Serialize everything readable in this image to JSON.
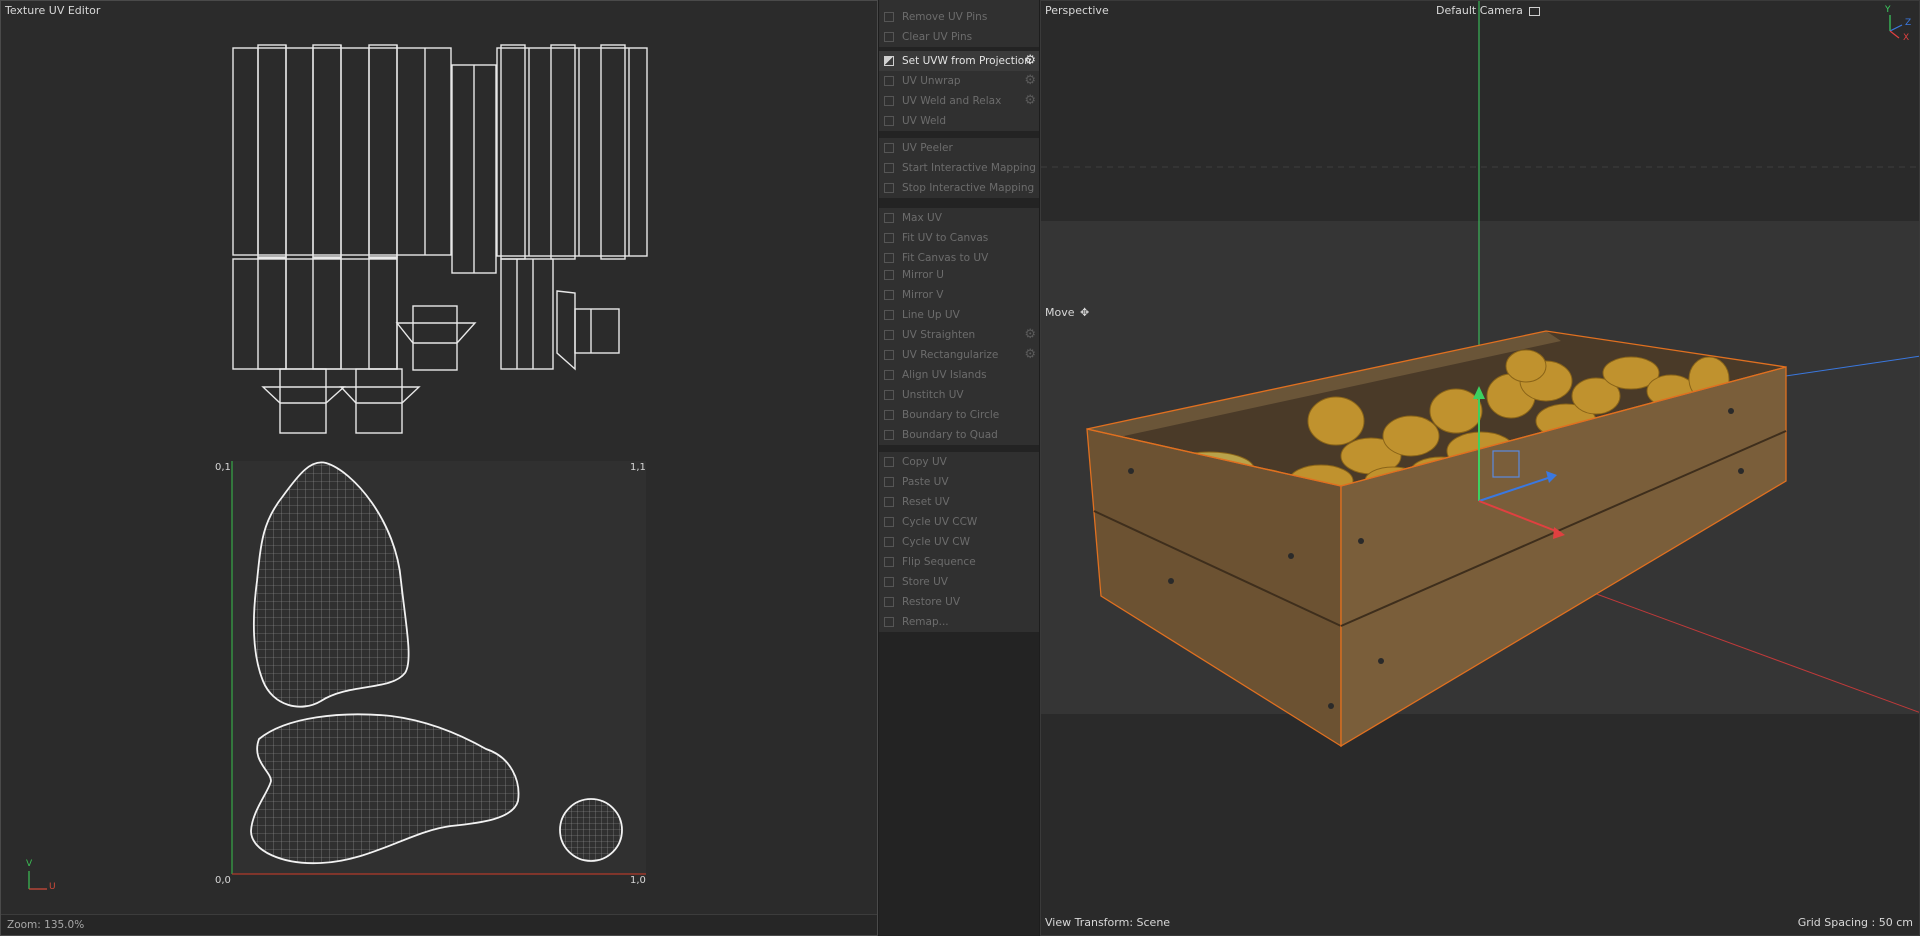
{
  "uv_editor": {
    "title": "Texture UV Editor",
    "corner_labels": {
      "top_left": "0,1",
      "top_right": "1,1",
      "bottom_left": "0,0",
      "bottom_right": "1,0"
    },
    "axis_v": "V",
    "axis_u": "U",
    "zoom": "Zoom: 135.0%"
  },
  "commands": {
    "groups": [
      [
        {
          "label": "Remove UV Pins",
          "icon": "pin-remove-icon",
          "enabled": false,
          "gear": false
        },
        {
          "label": "Clear UV Pins",
          "icon": "pin-clear-icon",
          "enabled": false,
          "gear": false
        }
      ],
      [
        {
          "label": "Set UVW from Projection",
          "icon": "projection-icon",
          "enabled": true,
          "gear": true
        },
        {
          "label": "UV Unwrap",
          "icon": "unwrap-icon",
          "enabled": false,
          "gear": true
        },
        {
          "label": "UV Weld and Relax",
          "icon": "weld-relax-icon",
          "enabled": false,
          "gear": true
        },
        {
          "label": "UV Weld",
          "icon": "weld-icon",
          "enabled": false,
          "gear": false
        }
      ],
      [
        {
          "label": "UV Peeler",
          "icon": "peeler-icon",
          "enabled": false,
          "gear": false
        },
        {
          "label": "Start Interactive Mapping",
          "icon": "play-icon",
          "enabled": false,
          "gear": false
        },
        {
          "label": "Stop Interactive Mapping",
          "icon": "stop-icon",
          "enabled": false,
          "gear": false
        }
      ],
      [
        {
          "label": "Max UV",
          "icon": "max-uv-icon",
          "enabled": false,
          "gear": false
        },
        {
          "label": "Fit UV to Canvas",
          "icon": "fit-uv-icon",
          "enabled": false,
          "gear": false
        },
        {
          "label": "Fit Canvas to UV",
          "icon": "fit-canvas-icon",
          "enabled": false,
          "gear": false
        }
      ],
      [
        {
          "label": "Mirror U",
          "icon": "mirror-u-icon",
          "enabled": false,
          "gear": false
        },
        {
          "label": "Mirror V",
          "icon": "mirror-v-icon",
          "enabled": false,
          "gear": false
        },
        {
          "label": "Line Up UV",
          "icon": "line-up-icon",
          "enabled": false,
          "gear": false
        },
        {
          "label": "UV Straighten",
          "icon": "straighten-icon",
          "enabled": false,
          "gear": true
        },
        {
          "label": "UV Rectangularize",
          "icon": "rectangularize-icon",
          "enabled": false,
          "gear": true
        },
        {
          "label": "Align UV Islands",
          "icon": "align-icon",
          "enabled": false,
          "gear": false
        },
        {
          "label": "Unstitch UV",
          "icon": "unstitch-icon",
          "enabled": false,
          "gear": false
        },
        {
          "label": "Boundary to Circle",
          "icon": "circle-icon",
          "enabled": false,
          "gear": false
        },
        {
          "label": "Boundary to Quad",
          "icon": "quad-icon",
          "enabled": false,
          "gear": false
        }
      ],
      [
        {
          "label": "Copy UV",
          "icon": "copy-icon",
          "enabled": false,
          "gear": false
        },
        {
          "label": "Paste UV",
          "icon": "paste-icon",
          "enabled": false,
          "gear": false
        },
        {
          "label": "Reset UV",
          "icon": "reset-icon",
          "enabled": false,
          "gear": false
        },
        {
          "label": "Cycle UV CCW",
          "icon": "cycle-ccw-icon",
          "enabled": false,
          "gear": false
        },
        {
          "label": "Cycle UV CW",
          "icon": "cycle-cw-icon",
          "enabled": false,
          "gear": false
        },
        {
          "label": "Flip Sequence",
          "icon": "flip-icon",
          "enabled": false,
          "gear": false
        },
        {
          "label": "Store UV",
          "icon": "store-icon",
          "enabled": false,
          "gear": false
        },
        {
          "label": "Restore UV",
          "icon": "restore-icon",
          "enabled": false,
          "gear": false
        },
        {
          "label": "Remap...",
          "icon": "remap-icon",
          "enabled": false,
          "gear": false
        }
      ]
    ]
  },
  "viewport": {
    "view_name": "Perspective",
    "camera": "Default Camera",
    "camera_icon": "camera-icon",
    "tool": "Move",
    "tool_icon": "move-icon",
    "view_transform": "View Transform: Scene",
    "grid_spacing": "Grid Spacing : 50 cm",
    "axis_labels": {
      "y": "Y",
      "z": "Z",
      "x": "X"
    },
    "colors": {
      "x_axis": "#e04040",
      "y_axis": "#3cd060",
      "z_axis": "#3a78e0",
      "selection": "#e07020"
    }
  }
}
